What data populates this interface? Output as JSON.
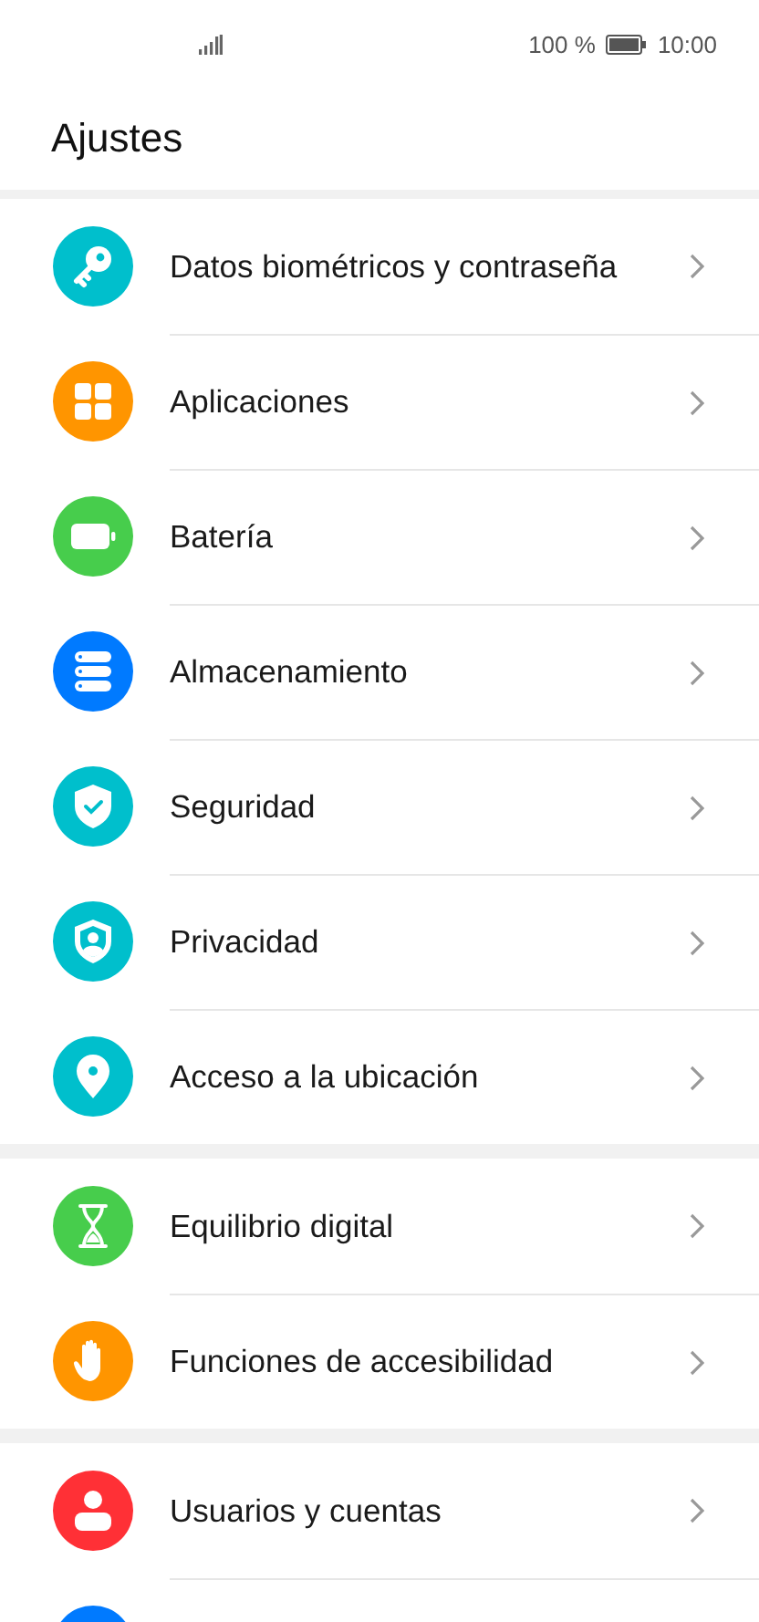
{
  "status_bar": {
    "battery_text": "100 %",
    "time": "10:00"
  },
  "title": "Ajustes",
  "sections": [
    {
      "items": [
        {
          "label": "Datos biométricos y contraseña",
          "color": "#00bfcc"
        },
        {
          "label": "Aplicaciones",
          "color": "#ff9500"
        },
        {
          "label": "Batería",
          "color": "#47cd4c"
        },
        {
          "label": "Almacenamiento",
          "color": "#007aff"
        },
        {
          "label": "Seguridad",
          "color": "#00bfcc"
        },
        {
          "label": "Privacidad",
          "color": "#00bfcc"
        },
        {
          "label": "Acceso a la ubicación",
          "color": "#00bfcc"
        }
      ]
    },
    {
      "items": [
        {
          "label": "Equilibrio digital",
          "color": "#47cd4c"
        },
        {
          "label": "Funciones de accesibilidad",
          "color": "#ff9500"
        }
      ]
    },
    {
      "items": [
        {
          "label": "Usuarios y cuentas",
          "color": "#ff3036"
        },
        {
          "color": "#007aff"
        }
      ]
    }
  ]
}
